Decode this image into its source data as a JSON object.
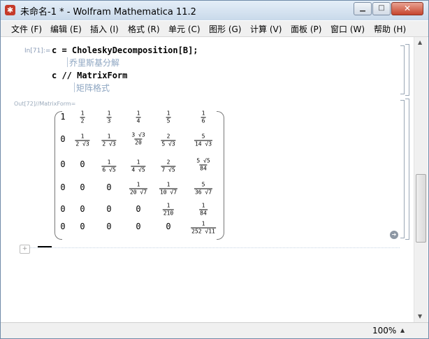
{
  "window": {
    "title": "未命名-1 * - Wolfram Mathematica 11.2",
    "icon": "mathematica-spikey-icon",
    "min_glyph": "▁",
    "max_glyph": "□",
    "close_glyph": "✕"
  },
  "menu": [
    {
      "label": "文件 (F)"
    },
    {
      "label": "编辑 (E)"
    },
    {
      "label": "插入 (I)"
    },
    {
      "label": "格式 (R)"
    },
    {
      "label": "单元 (C)"
    },
    {
      "label": "图形 (G)"
    },
    {
      "label": "计算 (V)"
    },
    {
      "label": "面板 (P)"
    },
    {
      "label": "窗口 (W)"
    },
    {
      "label": "帮助 (H)"
    }
  ],
  "notebook": {
    "input_label": "In[71]:=",
    "line1_code": "c = CholeskyDecomposition[B];",
    "line1_comment": "乔里斯基分解",
    "line2_code": "c // MatrixForm",
    "line2_comment": "矩阵格式",
    "output_label": "Out[72]//MatrixForm=",
    "matrix": {
      "row1": {
        "c1": "1",
        "c2n": "1",
        "c2d": "2",
        "c3n": "1",
        "c3d": "3",
        "c4n": "1",
        "c4d": "4",
        "c5n": "1",
        "c5d": "5",
        "c6n": "1",
        "c6d": "6"
      },
      "row2": {
        "c1": "0",
        "c2n": "1",
        "c2d": "2 √3",
        "c3n": "1",
        "c3d": "2 √3",
        "c4n": "3 √3",
        "c4d": "20",
        "c5n": "2",
        "c5d": "5 √3",
        "c6n": "5",
        "c6d": "14 √3"
      },
      "row3": {
        "c1": "0",
        "c2": "0",
        "c3n": "1",
        "c3d": "6 √5",
        "c4n": "1",
        "c4d": "4 √5",
        "c5n": "2",
        "c5d": "7 √5",
        "c6n": "5 √5",
        "c6d": "84"
      },
      "row4": {
        "c1": "0",
        "c2": "0",
        "c3": "0",
        "c4n": "1",
        "c4d": "20 √7",
        "c5n": "1",
        "c5d": "10 √7",
        "c6n": "5",
        "c6d": "36 √7"
      },
      "row5": {
        "c1": "0",
        "c2": "0",
        "c3": "0",
        "c4": "0",
        "c5n": "1",
        "c5d": "210",
        "c6n": "1",
        "c6d": "84"
      },
      "row6": {
        "c1": "0",
        "c2": "0",
        "c3": "0",
        "c4": "0",
        "c5": "0",
        "c6n": "1",
        "c6d": "252 √11"
      }
    },
    "more_glyph": "➔",
    "insert_glyph": "+"
  },
  "scrollbar": {
    "up": "▲",
    "down": "▼"
  },
  "status": {
    "zoom": "100%",
    "zoom_arrow": "▲"
  }
}
